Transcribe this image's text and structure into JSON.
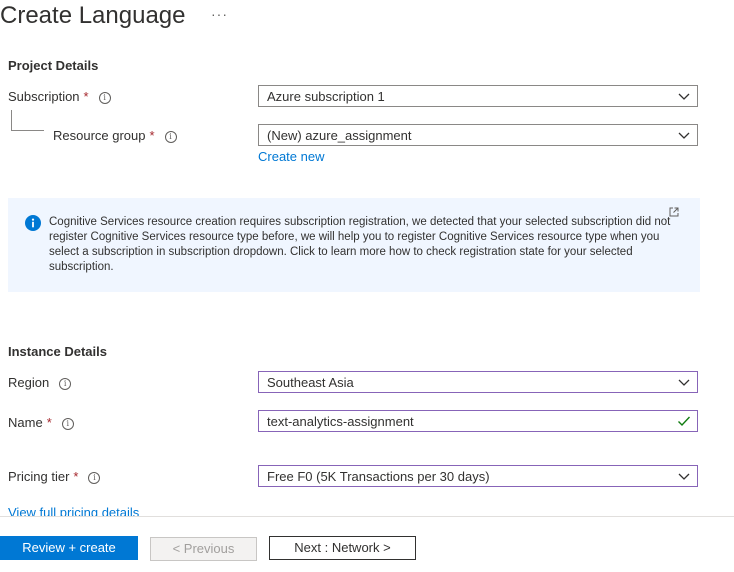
{
  "page": {
    "title": "Create Language",
    "more_glyph": "···"
  },
  "project_details": {
    "heading": "Project Details",
    "subscription": {
      "label": "Subscription",
      "required": "*",
      "value": "Azure subscription 1"
    },
    "resource_group": {
      "label": "Resource group",
      "required": "*",
      "value": "(New) azure_assignment",
      "create_new": "Create new"
    }
  },
  "banner": {
    "text": "Cognitive Services resource creation requires subscription registration, we detected that your selected subscription did not register Cognitive Services resource type before, we will help you to register Cognitive Services resource type when you select a subscription in subscription dropdown. Click to learn more how to check registration state for your selected subscription.",
    "icon": "info-icon",
    "link_icon": "external-link-icon"
  },
  "instance_details": {
    "heading": "Instance Details",
    "region": {
      "label": "Region",
      "value": "Southeast Asia"
    },
    "name": {
      "label": "Name",
      "required": "*",
      "value": "text-analytics-assignment"
    },
    "pricing_tier": {
      "label": "Pricing tier",
      "required": "*",
      "value": "Free F0 (5K Transactions per 30 days)"
    },
    "pricing_link": "View full pricing details"
  },
  "footer": {
    "review_create": "Review + create",
    "previous": "< Previous",
    "next": "Next : Network >"
  },
  "colors": {
    "accent": "#0078d4",
    "required": "#a4262c",
    "focus_border": "#8764b8",
    "banner_bg": "#f0f6ff",
    "valid_check": "#107c10"
  }
}
